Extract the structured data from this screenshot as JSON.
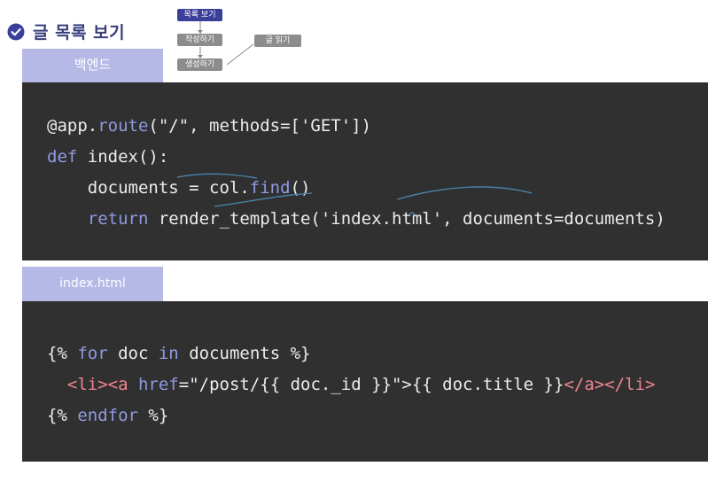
{
  "header": {
    "title": "글 목록 보기",
    "check_icon": "check-circle-icon",
    "accent_color": "#3a3f9a"
  },
  "flow": {
    "nodes": [
      "목록 보기",
      "작성하기",
      "생성하기",
      "글 읽기"
    ],
    "active": "목록 보기"
  },
  "backend": {
    "tab_label": "백엔드",
    "lines": [
      [
        {
          "t": "@app."
        },
        {
          "t": "route",
          "k": "kw"
        },
        {
          "t": "(\"/\", methods=['GET'])"
        }
      ],
      [
        {
          "t": "def",
          "k": "kw"
        },
        {
          "t": " index():"
        }
      ],
      [
        {
          "t": "    documents = col."
        },
        {
          "t": "find",
          "k": "kw"
        },
        {
          "t": "()"
        }
      ],
      [
        {
          "t": "    "
        },
        {
          "t": "return",
          "k": "kw"
        },
        {
          "t": " render_template('index.html', documents=documents)"
        }
      ]
    ]
  },
  "template": {
    "tab_label": "index.html",
    "lines": [
      [
        {
          "t": "{% "
        },
        {
          "t": "for",
          "k": "kw"
        },
        {
          "t": " doc "
        },
        {
          "t": "in",
          "k": "kw"
        },
        {
          "t": " documents %}"
        }
      ],
      [
        {
          "t": "  "
        },
        {
          "t": "<li><a",
          "k": "tag"
        },
        {
          "t": " "
        },
        {
          "t": "href",
          "k": "kw"
        },
        {
          "t": "=\"/post/{{ doc._id }}\">{{ doc.title }}"
        },
        {
          "t": "</a></li>",
          "k": "tag"
        }
      ],
      [
        {
          "t": "{% "
        },
        {
          "t": "endfor",
          "k": "kw"
        },
        {
          "t": " %}"
        }
      ]
    ]
  },
  "colors": {
    "code_bg": "#303030",
    "keyword": "#8f9ae0",
    "tag": "#f08490",
    "tab_bg": "#b6b8e6"
  }
}
